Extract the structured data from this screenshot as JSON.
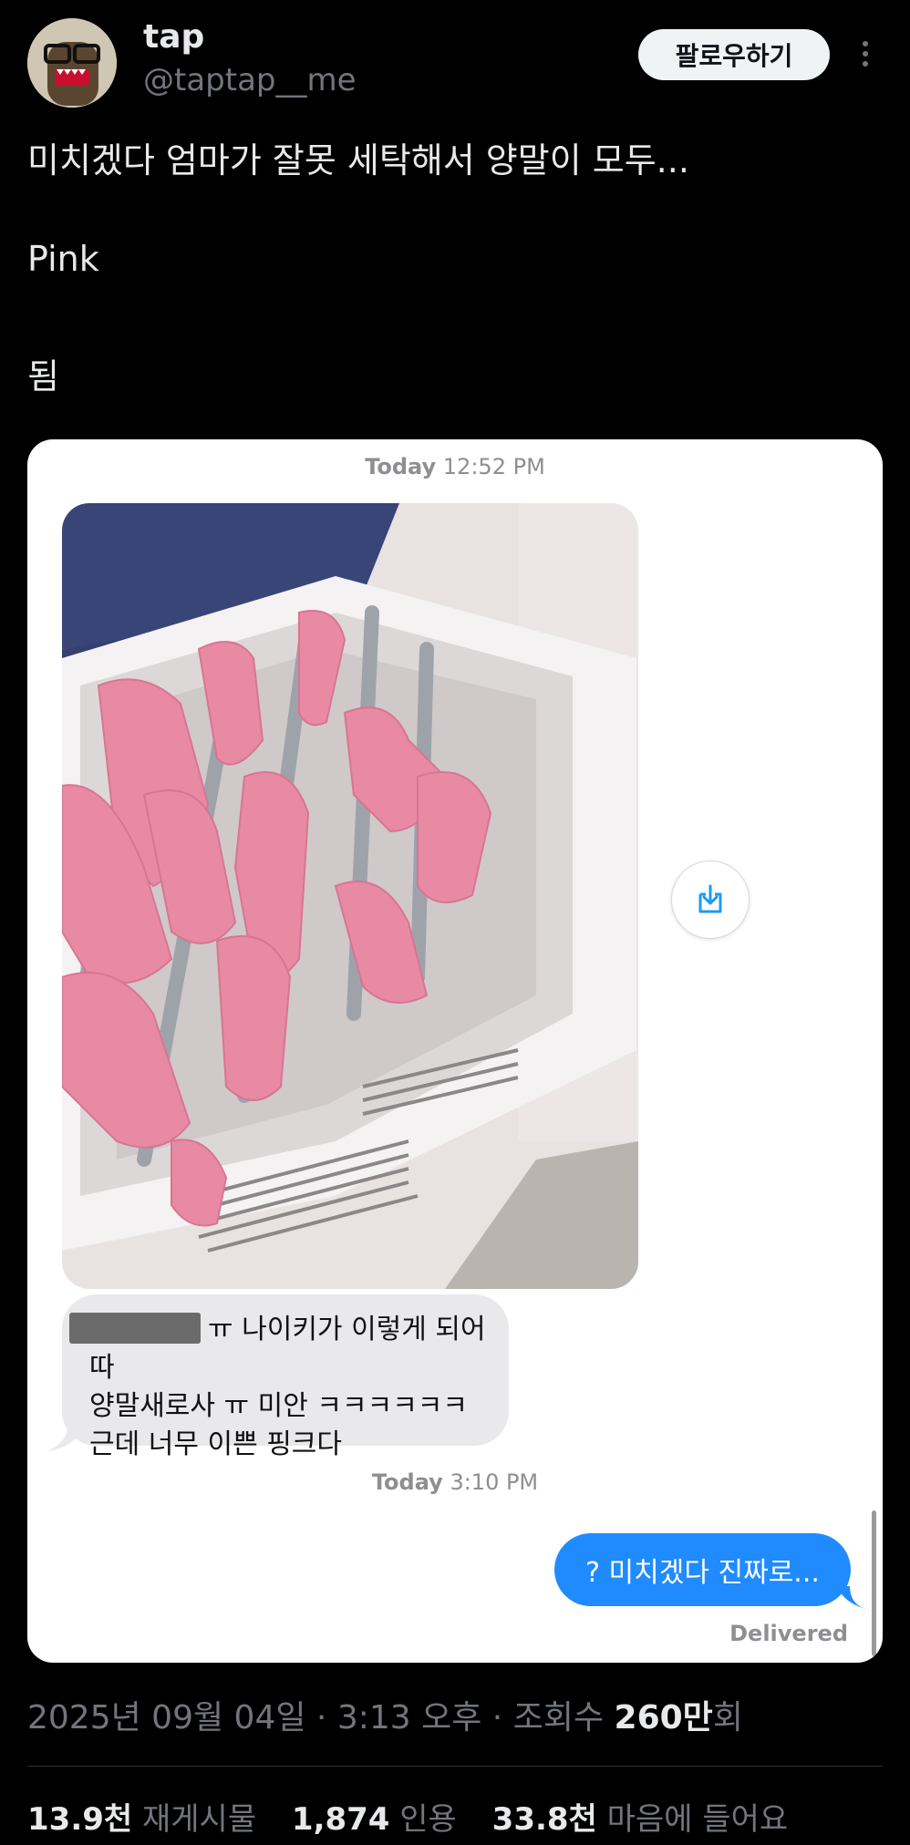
{
  "user": {
    "name": "tap",
    "handle": "@taptap__me",
    "follow_label": "팔로우하기"
  },
  "tweet": {
    "line1": "미치겠다 엄마가 잘못 세탁해서 양말이 모두...",
    "line2": "Pink",
    "line3": "됨"
  },
  "media": {
    "timestamp1_day": "Today",
    "timestamp1_time": "12:52 PM",
    "incoming_line1": "ㅠ 나이키가 이렇게 되어따",
    "incoming_line2": "양말새로사 ㅠ 미안 ㅋㅋㅋㅋㅋㅋ",
    "incoming_line3": "근데 너무 이쁜 핑크다",
    "timestamp2_day": "Today",
    "timestamp2_time": "3:10 PM",
    "outgoing": "? 미치겠다 진짜로...",
    "delivered": "Delivered"
  },
  "meta": {
    "date": "2025년 09월 04일",
    "time": "3:13 오후",
    "views_label": "조회수",
    "views_value": "260만",
    "views_suffix": "회"
  },
  "stats": {
    "retweets_value": "13.9천",
    "retweets_label": "재게시물",
    "quotes_value": "1,874",
    "quotes_label": "인용",
    "likes_value": "33.8천",
    "likes_label": "마음에 들어요"
  },
  "colors": {
    "bubble_out": "#1f8bff",
    "bubble_in": "#e9e9eb",
    "sock_pink": "#e88aa4"
  }
}
